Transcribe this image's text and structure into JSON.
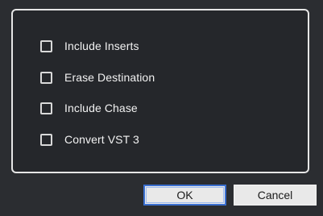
{
  "options": [
    {
      "label": "Include Inserts",
      "checked": false
    },
    {
      "label": "Erase Destination",
      "checked": false
    },
    {
      "label": "Include Chase",
      "checked": false
    },
    {
      "label": "Convert VST 3",
      "checked": false
    }
  ],
  "buttons": {
    "ok_label": "OK",
    "cancel_label": "Cancel"
  },
  "colors": {
    "background": "#2b2d31",
    "panel_border": "#e6e6e6",
    "text": "#f2f2f2",
    "button_face": "#e9e9e9",
    "focus_ring": "#3a6fd0"
  }
}
